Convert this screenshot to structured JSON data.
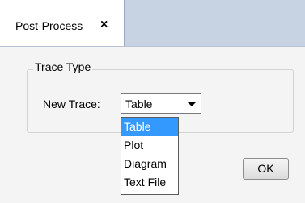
{
  "tab": {
    "label": "Post-Process",
    "close_glyph": "×"
  },
  "trace_type_group": {
    "title": "Trace Type",
    "new_trace_label": "New Trace:",
    "selected_value": "Table",
    "options": [
      "Table",
      "Plot",
      "Diagram",
      "Text File"
    ]
  },
  "ok_button": {
    "label": "OK"
  },
  "colors": {
    "tab_strip": "#c7d3e3",
    "panel": "#f4f4f4",
    "selection": "#3399ff"
  }
}
